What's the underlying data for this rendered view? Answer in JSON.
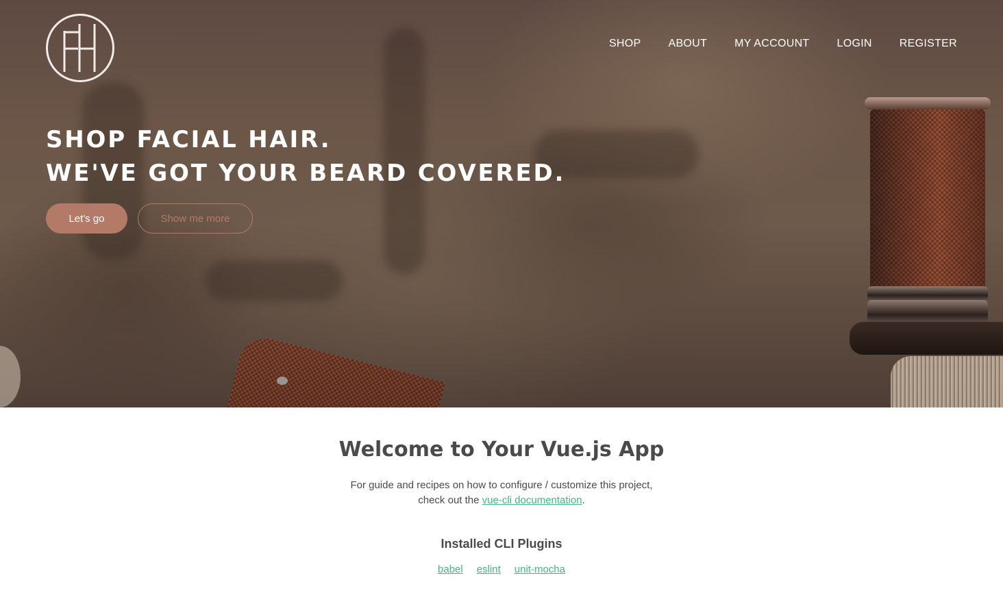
{
  "brand": {
    "logo_text": "FH"
  },
  "nav": {
    "items": [
      {
        "label": "SHOP"
      },
      {
        "label": "ABOUT"
      },
      {
        "label": "MY ACCOUNT"
      },
      {
        "label": "LOGIN"
      },
      {
        "label": "REGISTER"
      }
    ]
  },
  "hero": {
    "headline_line1": "SHOP FACIAL HAIR.",
    "headline_line2": "WE'VE GOT YOUR BEARD COVERED.",
    "primary_button": "Let's go",
    "secondary_button": "Show me more",
    "accent_color": "#b47a68"
  },
  "content": {
    "title": "Welcome to Your Vue.js App",
    "guide_text_1": "For guide and recipes on how to configure / customize this project,",
    "guide_text_2": "check out the",
    "guide_link": "vue-cli documentation",
    "guide_text_end": ".",
    "plugins_heading": "Installed CLI Plugins",
    "plugins": [
      {
        "label": "babel"
      },
      {
        "label": "eslint"
      },
      {
        "label": "unit-mocha"
      }
    ],
    "link_color": "#42b983"
  }
}
